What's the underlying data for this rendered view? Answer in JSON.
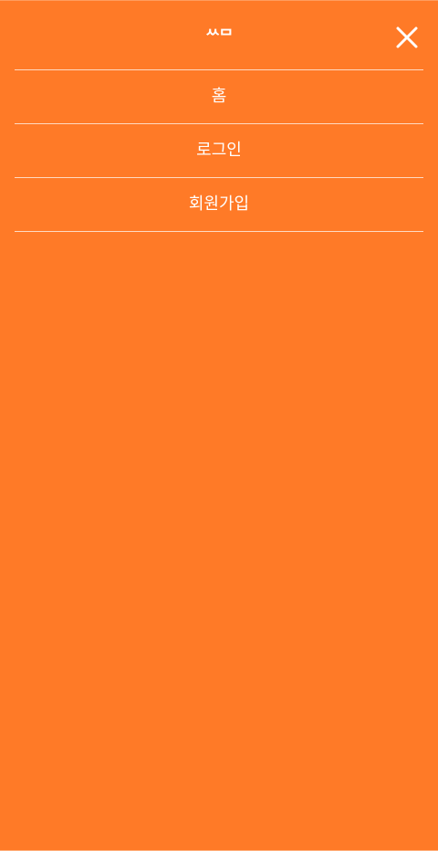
{
  "header": {
    "logo_text": "ᄊᄆ",
    "close_icon": "close-icon"
  },
  "menu": {
    "items": [
      {
        "label": "홈"
      },
      {
        "label": "로그인"
      },
      {
        "label": "회원가입"
      }
    ]
  },
  "colors": {
    "background": "#ff7a27",
    "text": "#ffffff",
    "divider": "#ffffff"
  }
}
